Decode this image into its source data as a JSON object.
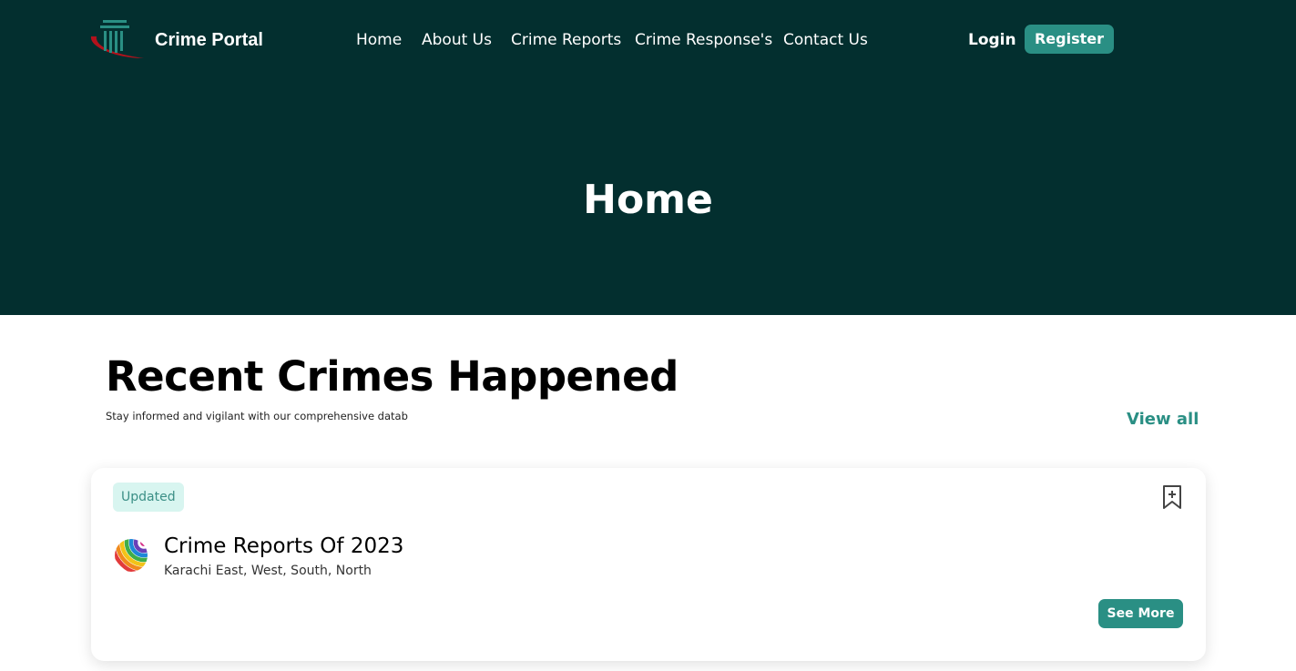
{
  "header": {
    "brand_name": "Crime Portal",
    "nav": [
      {
        "label": "Home"
      },
      {
        "label": "About Us"
      },
      {
        "label": "Crime Reports"
      },
      {
        "label": "Crime Response's"
      },
      {
        "label": "Contact Us"
      }
    ],
    "login_label": "Login",
    "register_label": "Register"
  },
  "hero": {
    "title": "Home"
  },
  "recent": {
    "title": "Recent Crimes Happened",
    "subtitle": "Stay informed and vigilant with our comprehensive datab",
    "view_all_label": "View all",
    "card": {
      "badge": "Updated",
      "title": "Crime Reports Of 2023",
      "locations": "Karachi East, West, South, North",
      "see_more_label": "See More",
      "icon": "colorful-sphere-icon",
      "bookmark_icon": "bookmark-add-icon"
    }
  },
  "colors": {
    "header_bg": "#032f2f",
    "accent": "#2a8f84",
    "badge_bg": "#d8f5f0",
    "logo_red": "#b3121c"
  }
}
